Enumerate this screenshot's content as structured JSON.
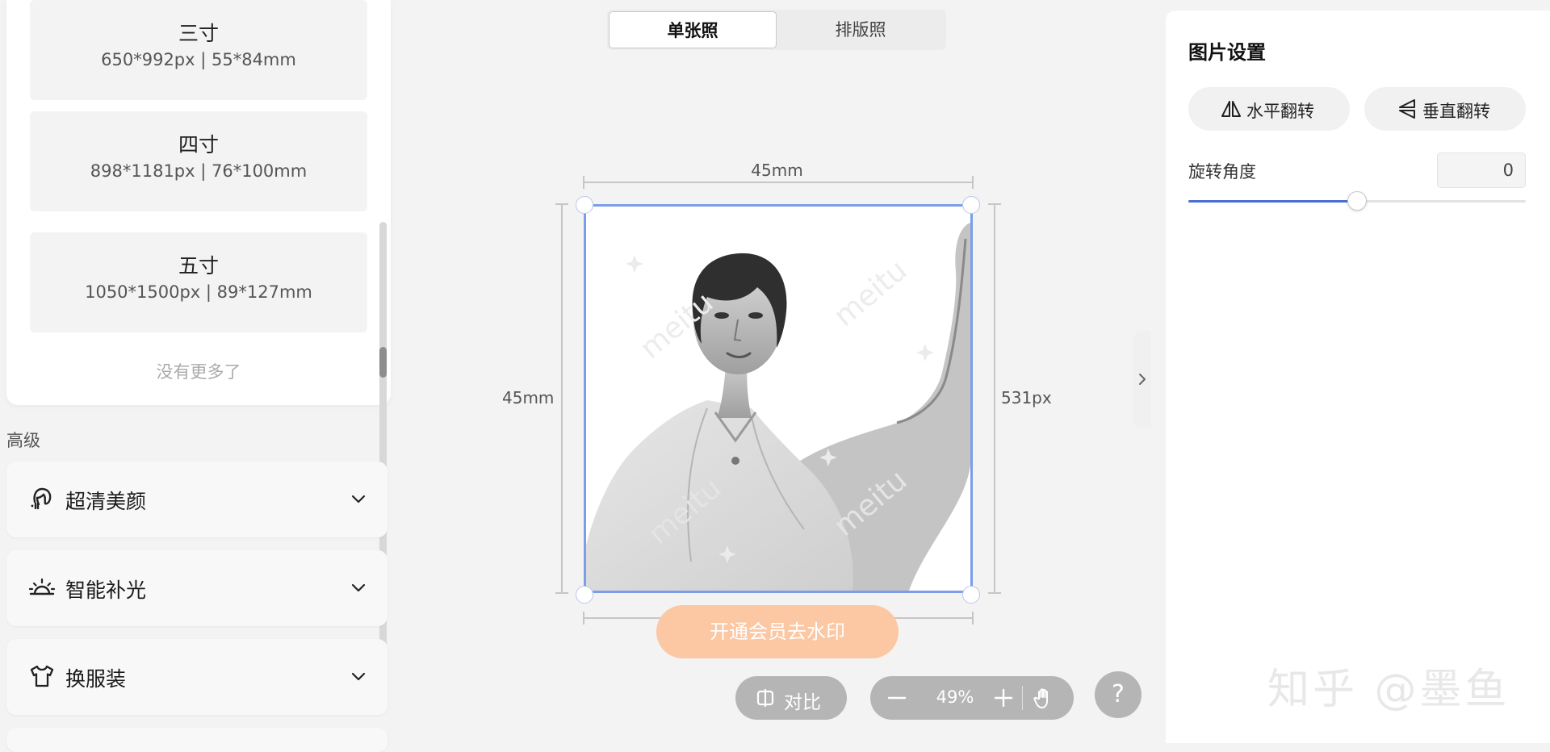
{
  "sizes": [
    {
      "name": "三寸",
      "dims": "650*992px | 55*84mm"
    },
    {
      "name": "四寸",
      "dims": "898*1181px | 76*100mm"
    },
    {
      "name": "五寸",
      "dims": "1050*1500px | 89*127mm"
    }
  ],
  "no_more_text": "没有更多了",
  "advanced": {
    "section_label": "高级",
    "items": [
      {
        "label": "超清美颜",
        "icon": "face-beauty-icon"
      },
      {
        "label": "智能补光",
        "icon": "sunrise-light-icon"
      },
      {
        "label": "换服装",
        "icon": "tshirt-icon"
      }
    ]
  },
  "canvas": {
    "tabs": [
      {
        "label": "单张照",
        "active": true
      },
      {
        "label": "排版照",
        "active": false
      }
    ],
    "dim_top": "45mm",
    "dim_left": "45mm",
    "dim_right": "531px",
    "watermark_button": "开通会员去水印",
    "watermark_text": "meitu",
    "compare_label": "对比",
    "zoom_value": "49%",
    "help_label": "?"
  },
  "settings": {
    "title": "图片设置",
    "flip_horizontal": "水平翻转",
    "flip_vertical": "垂直翻转",
    "rotation_label": "旋转角度",
    "rotation_value": "0",
    "rotation_slider_fraction": 0.5
  },
  "brand_overlay": "知乎 @墨鱼",
  "colors": {
    "accent": "#4a6fd0",
    "frame_border": "#7b9ee8",
    "watermark_button": "#fcc7a3"
  }
}
